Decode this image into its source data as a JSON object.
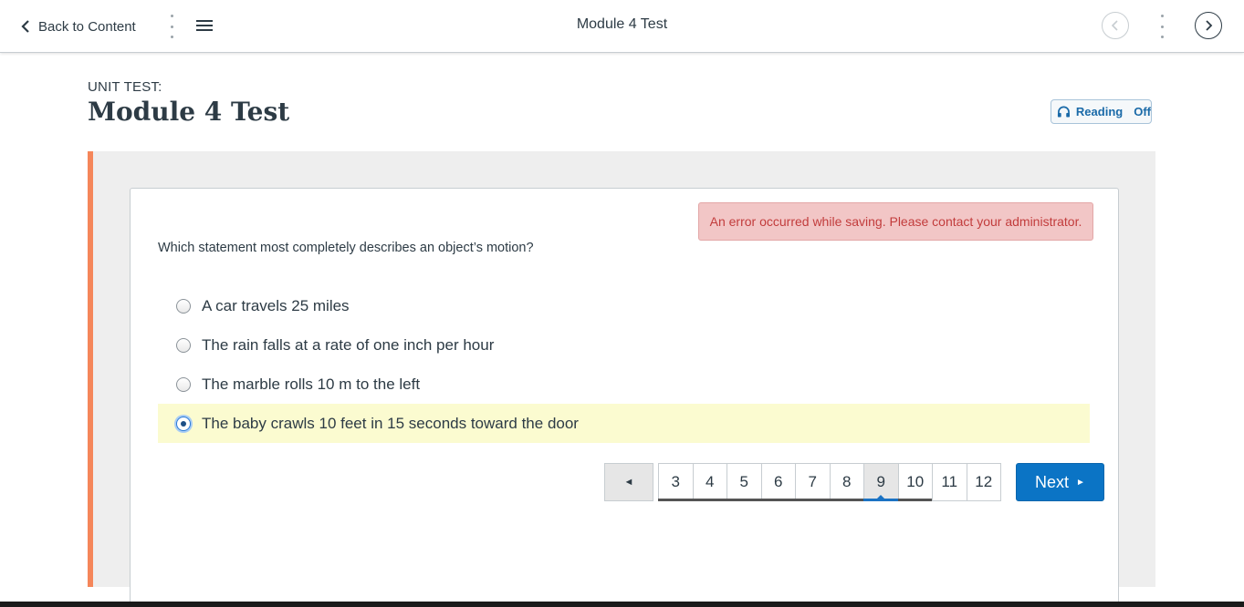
{
  "topbar": {
    "back_label": "Back to Content",
    "title": "Module 4 Test"
  },
  "header": {
    "unit_label": "UNIT TEST:",
    "title": "Module 4 Test",
    "reading_label": "Reading",
    "reading_state": "Off"
  },
  "error_message": "An error occurred while saving. Please contact your administrator.",
  "question": {
    "text": "Which statement most completely describes an object’s motion?",
    "answers": [
      {
        "text": "A car travels 25 miles",
        "selected": false
      },
      {
        "text": "The rain falls at a rate of one inch per hour",
        "selected": false
      },
      {
        "text": "The marble rolls 10 m to the left",
        "selected": false
      },
      {
        "text": "The baby crawls 10 feet in 15 seconds toward the door",
        "selected": true
      }
    ]
  },
  "pagination": {
    "prev_symbol": "◄",
    "pages": [
      "3",
      "4",
      "5",
      "6",
      "7",
      "8",
      "9",
      "10",
      "11",
      "12"
    ],
    "current": "9",
    "next_label": "Next",
    "next_symbol": "►"
  },
  "colors": {
    "accent_bar": "#f5865a",
    "primary": "#0b74c5",
    "error_bg": "#f2c6c6",
    "selected_bg": "#fbfbd0"
  }
}
